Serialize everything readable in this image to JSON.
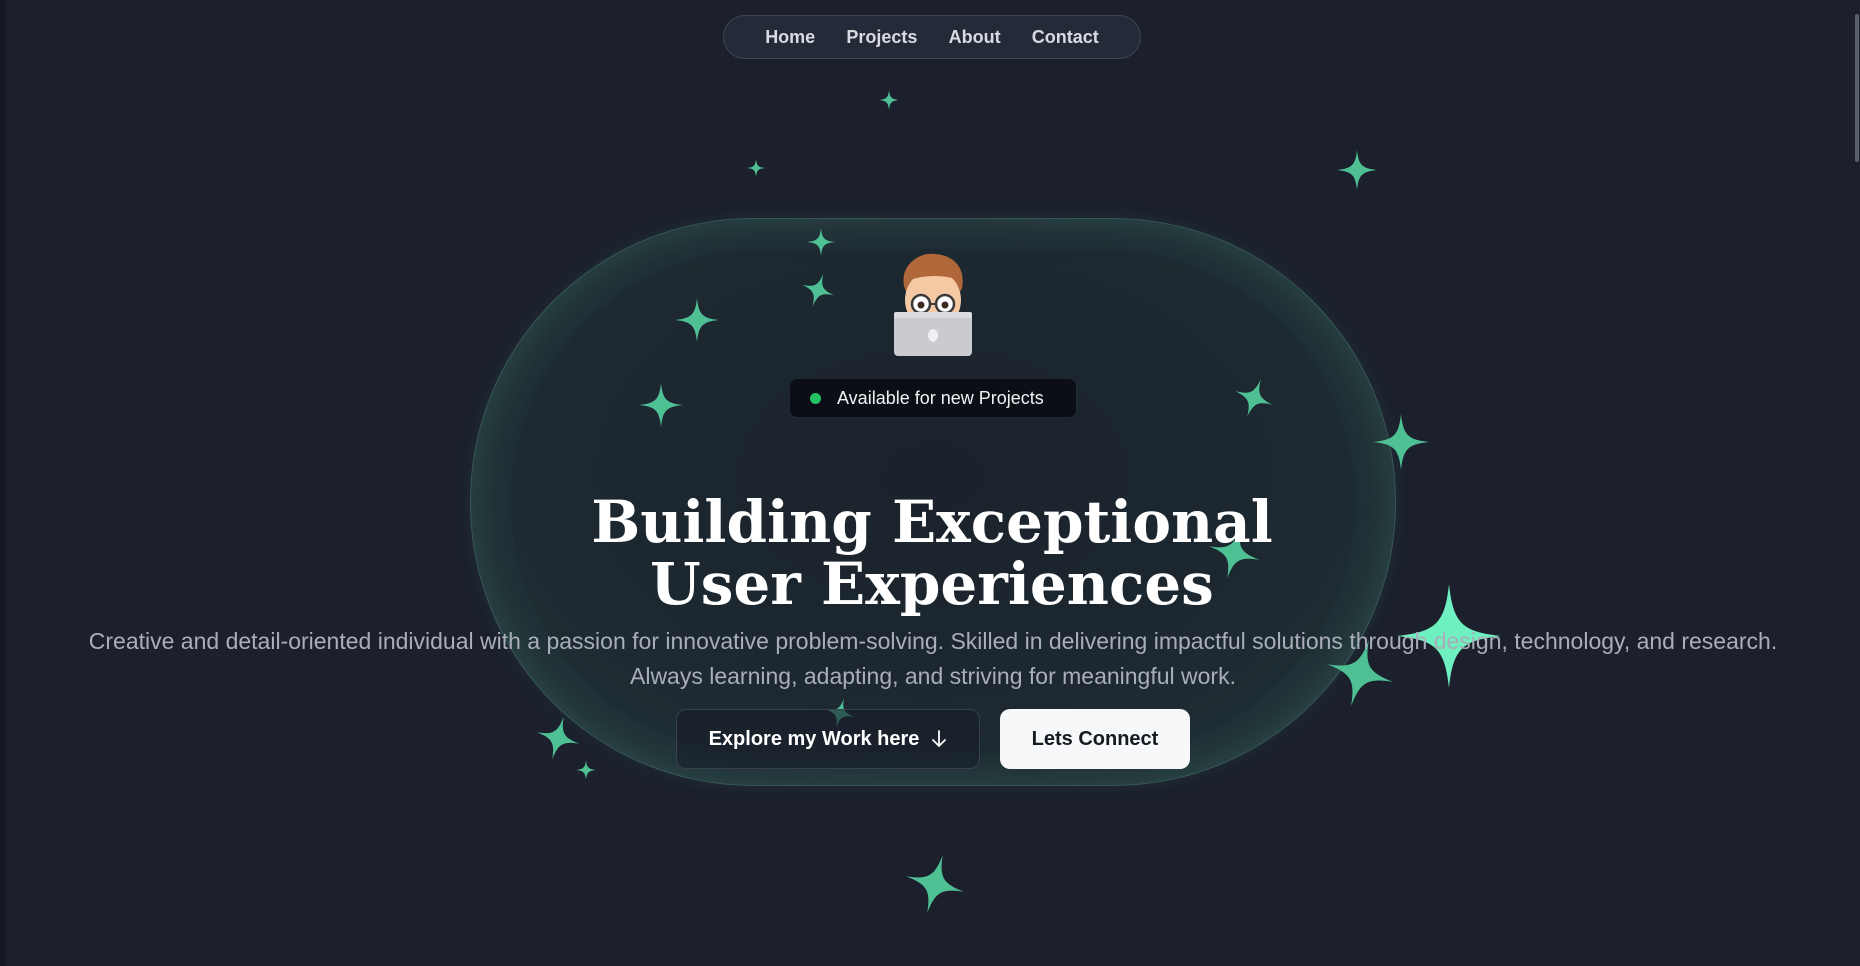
{
  "nav": {
    "items": [
      {
        "label": "Home"
      },
      {
        "label": "Projects"
      },
      {
        "label": "About"
      },
      {
        "label": "Contact"
      }
    ]
  },
  "hero": {
    "avatar_icon": "memoji-laptop-icon",
    "status_badge": {
      "label": "Available for new Projects",
      "dot_color": "#23c265"
    },
    "title_line1": "Building Exceptional",
    "title_line2": "User Experiences",
    "description_line1": "Creative and detail-oriented individual with a passion for innovative problem-solving. Skilled in delivering impactful solutions through design, technology, and research.",
    "description_line2": "Always learning, adapting, and striving for meaningful work.",
    "primary_button": {
      "label": "Explore my Work here",
      "icon": "arrow-down-icon"
    },
    "secondary_button": {
      "label": "Lets Connect"
    }
  },
  "colors": {
    "background": "#1b202c",
    "accent": "#5fd4a4",
    "text_primary": "#ffffff",
    "text_muted": "#a9aeb9"
  }
}
